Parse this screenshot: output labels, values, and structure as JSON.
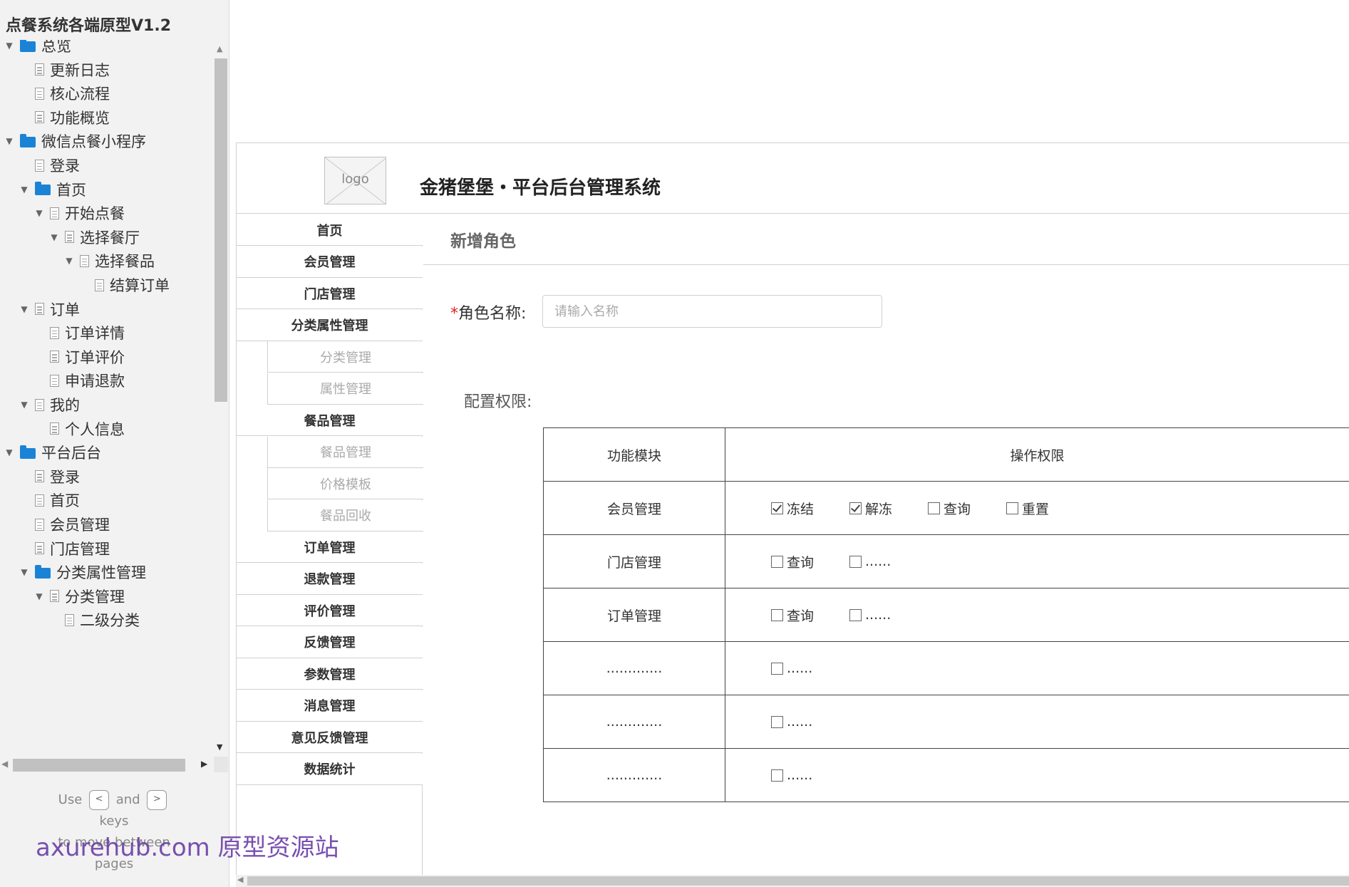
{
  "sitemap": {
    "title": "点餐系统各端原型V1.2",
    "items": [
      {
        "label": "总览",
        "type": "folder",
        "level": 0,
        "expanded": true
      },
      {
        "label": "更新日志",
        "type": "page",
        "level": 1
      },
      {
        "label": "核心流程",
        "type": "page",
        "level": 1
      },
      {
        "label": "功能概览",
        "type": "page",
        "level": 1
      },
      {
        "label": "微信点餐小程序",
        "type": "folder",
        "level": 0,
        "expanded": true
      },
      {
        "label": "登录",
        "type": "page",
        "level": 1
      },
      {
        "label": "首页",
        "type": "folder",
        "level": 1,
        "expanded": true
      },
      {
        "label": "开始点餐",
        "type": "page",
        "level": 2,
        "expanded": true
      },
      {
        "label": "选择餐厅",
        "type": "page",
        "level": 3,
        "expanded": true
      },
      {
        "label": "选择餐品",
        "type": "page",
        "level": 4,
        "expanded": true
      },
      {
        "label": "结算订单",
        "type": "page",
        "level": 5
      },
      {
        "label": "订单",
        "type": "page",
        "level": 1,
        "expanded": true
      },
      {
        "label": "订单详情",
        "type": "page",
        "level": 2
      },
      {
        "label": "订单评价",
        "type": "page",
        "level": 2
      },
      {
        "label": "申请退款",
        "type": "page",
        "level": 2
      },
      {
        "label": "我的",
        "type": "page",
        "level": 1,
        "expanded": true
      },
      {
        "label": "个人信息",
        "type": "page",
        "level": 2
      },
      {
        "label": "平台后台",
        "type": "folder",
        "level": 0,
        "expanded": true
      },
      {
        "label": "登录",
        "type": "page",
        "level": 1
      },
      {
        "label": "首页",
        "type": "page",
        "level": 1
      },
      {
        "label": "会员管理",
        "type": "page",
        "level": 1
      },
      {
        "label": "门店管理",
        "type": "page",
        "level": 1
      },
      {
        "label": "分类属性管理",
        "type": "folder",
        "level": 1,
        "expanded": true
      },
      {
        "label": "分类管理",
        "type": "page",
        "level": 2,
        "expanded": true
      },
      {
        "label": "二级分类",
        "type": "page",
        "level": 3
      }
    ],
    "hint": {
      "use": "Use",
      "prev_key": "<",
      "and": "and",
      "next_key": ">",
      "keys": "keys",
      "to_move": "to move between",
      "pages": "pages"
    }
  },
  "watermark": "axurehub.com 原型资源站",
  "frame": {
    "logo_text": "logo",
    "system_title": "金猪堡堡・平台后台管理系统",
    "menu": [
      {
        "label": "首页",
        "kind": "main"
      },
      {
        "label": "会员管理",
        "kind": "main"
      },
      {
        "label": "门店管理",
        "kind": "main"
      },
      {
        "label": "分类属性管理",
        "kind": "main"
      },
      {
        "label": "分类管理",
        "kind": "sub"
      },
      {
        "label": "属性管理",
        "kind": "sub"
      },
      {
        "label": "餐品管理",
        "kind": "main"
      },
      {
        "label": "餐品管理",
        "kind": "sub"
      },
      {
        "label": "价格模板",
        "kind": "sub"
      },
      {
        "label": "餐品回收",
        "kind": "sub"
      },
      {
        "label": "订单管理",
        "kind": "main"
      },
      {
        "label": "退款管理",
        "kind": "main"
      },
      {
        "label": "评价管理",
        "kind": "main"
      },
      {
        "label": "反馈管理",
        "kind": "main"
      },
      {
        "label": "参数管理",
        "kind": "main"
      },
      {
        "label": "消息管理",
        "kind": "main"
      },
      {
        "label": "意见反馈管理",
        "kind": "main"
      },
      {
        "label": "数据统计",
        "kind": "main"
      }
    ],
    "page_heading": "新增角色",
    "role_name": {
      "required_mark": "*",
      "label": "角色名称:",
      "placeholder": "请输入名称",
      "value": ""
    },
    "perm_label": "配置权限:",
    "table": {
      "headers": [
        "功能模块",
        "操作权限"
      ],
      "rows": [
        {
          "module": "会员管理",
          "ops": [
            {
              "label": "冻结",
              "checked": true
            },
            {
              "label": "解冻",
              "checked": true
            },
            {
              "label": "查询",
              "checked": false
            },
            {
              "label": "重置",
              "checked": false
            }
          ]
        },
        {
          "module": "门店管理",
          "ops": [
            {
              "label": "查询",
              "checked": false
            },
            {
              "label": "......",
              "checked": false
            }
          ]
        },
        {
          "module": "订单管理",
          "ops": [
            {
              "label": "查询",
              "checked": false
            },
            {
              "label": "......",
              "checked": false
            }
          ]
        },
        {
          "module": ".............",
          "ops": [
            {
              "label": "......",
              "checked": false
            }
          ]
        },
        {
          "module": ".............",
          "ops": [
            {
              "label": "......",
              "checked": false
            }
          ]
        },
        {
          "module": ".............",
          "ops": [
            {
              "label": "......",
              "checked": false
            }
          ]
        }
      ]
    }
  }
}
